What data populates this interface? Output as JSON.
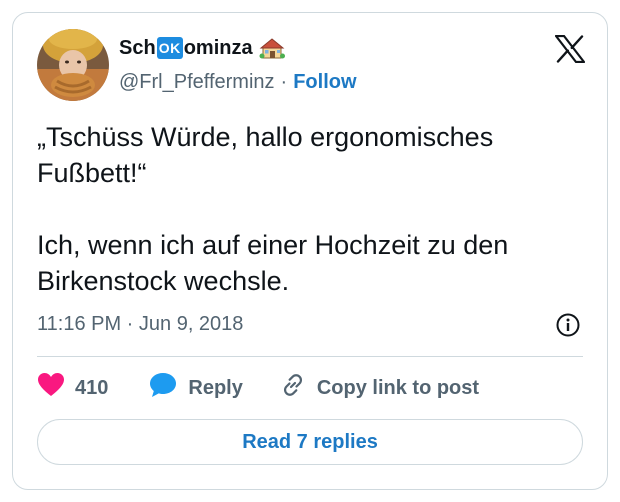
{
  "author": {
    "name_prefix": "Sch",
    "name_badge": "OK",
    "name_suffix": "ominza",
    "handle": "@Frl_Pfefferminz",
    "separator": "·",
    "follow_label": "Follow"
  },
  "tweet": {
    "text": "„Tschüss Würde, hallo ergonomisches Fußbett!“\n\nIch, wenn ich auf einer Hochzeit zu den Birkenstock wechsle.",
    "timestamp": "11:16 PM · Jun 9, 2018"
  },
  "actions": {
    "like_count": "410",
    "reply_label": "Reply",
    "copy_link_label": "Copy link to post"
  },
  "read_replies_label": "Read 7 replies",
  "colors": {
    "link": "#1d79c4",
    "like": "#f91880",
    "reply": "#1d9bf0",
    "muted": "#536471",
    "border": "#cfd9de"
  },
  "icons": {
    "brand": "x-logo-icon",
    "info": "info-icon",
    "like": "heart-icon",
    "reply": "speech-bubble-icon",
    "copy": "link-icon",
    "name_emoji": "house-icon"
  }
}
